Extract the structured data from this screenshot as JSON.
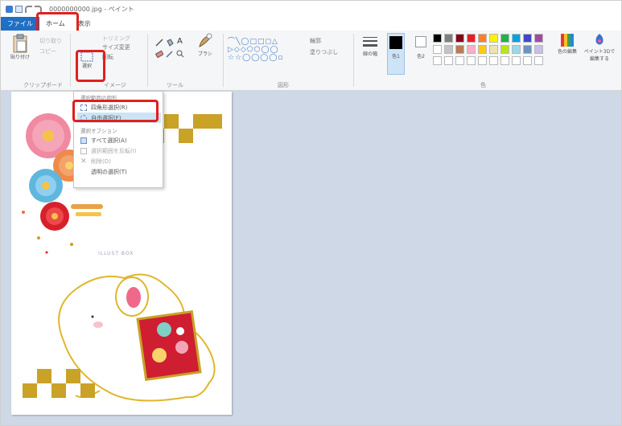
{
  "window": {
    "title": "0000000000.jpg - ペイント"
  },
  "tabs": {
    "file": "ファイル",
    "home": "ホーム",
    "view": "表示"
  },
  "ribbon": {
    "clipboard": {
      "paste": "貼り付け",
      "cut": "切り取り",
      "copy": "コピー",
      "group": "クリップボード"
    },
    "image": {
      "crop": "トリミング",
      "resize": "サイズ変更",
      "rotate": "回転",
      "select": "選択",
      "group": "イメージ"
    },
    "tools": {
      "brush": "ブラシ",
      "group": "ツール"
    },
    "shapes": {
      "outline": "輪郭",
      "fill": "塗りつぶし",
      "group": "図形"
    },
    "size": "線の幅",
    "colors": {
      "color1": "色1",
      "color2": "色2",
      "edit": "色の編集",
      "paint3d": "ペイント3Dで編集する",
      "group": "色"
    }
  },
  "select_menu": {
    "shape_header": "選択範囲の図形",
    "rect_select": "四角形選択(R)",
    "free_select": "自由選択(F)",
    "options_header": "選択オプション",
    "select_all": "すべて選択(A)",
    "invert": "選択範囲を反転(I)",
    "delete": "削除(D)",
    "transparent": "透明の選択(T)"
  },
  "canvas": {
    "watermark": "ILLUST BOX"
  },
  "colors": {
    "accent": "#1f6fc5",
    "highlight": "#e0201c",
    "palette": [
      "#000000",
      "#7f7f7f",
      "#880015",
      "#ed1c24",
      "#ff7f27",
      "#fff200",
      "#22b14c",
      "#00a2e8",
      "#3f48cc",
      "#a349a4",
      "#ffffff",
      "#c3c3c3",
      "#b97a57",
      "#ffaec9",
      "#ffc90e",
      "#efe4b0",
      "#b5e61d",
      "#99d9ea",
      "#7092be",
      "#c8bfe7"
    ]
  }
}
